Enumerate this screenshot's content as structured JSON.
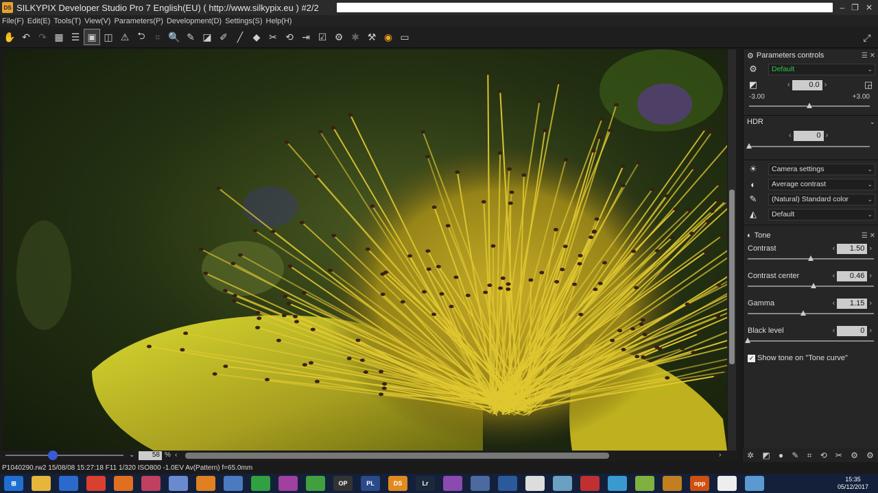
{
  "window": {
    "title": "SILKYPIX Developer Studio Pro 7 English(EU) ( http://www.silkypix.eu )  #2/2",
    "icon_label": "DS"
  },
  "menu": [
    "File(F)",
    "Edit(E)",
    "Tools(T)",
    "View(V)",
    "Parameters(P)",
    "Development(D)",
    "Settings(S)",
    "Help(H)"
  ],
  "toolbar": {
    "icons": [
      "hand-icon",
      "undo-icon",
      "redo-icon",
      "grid-view-icon",
      "filmstrip-view-icon",
      "single-view-icon",
      "compare-view-icon",
      "warning-icon",
      "rotate-left-icon",
      "crop-icon",
      "zoom-icon",
      "eyedropper-icon",
      "white-balance-icon",
      "spot-icon",
      "brush-icon",
      "gradient-icon",
      "tone-icon",
      "rotate-icon",
      "export-icon",
      "check-icon",
      "settings-icon",
      "star-icon",
      "hammer-icon",
      "ds-icon",
      "monitor-icon"
    ]
  },
  "viewer": {
    "zoom_value": "58",
    "zoom_unit": "%"
  },
  "status": {
    "text": "P1040290.rw2 15/08/08 15:27:18 F11 1/320 ISO800 -1.0EV Av(Pattern) f=65.0mm"
  },
  "panel": {
    "title": "Parameters controls",
    "taste": "Default",
    "exposure": {
      "value": "0.0",
      "min": "-3.00",
      "max": "+3.00",
      "level": 0.5
    },
    "hdr": {
      "label": "HDR",
      "value": "0",
      "level": 0.0
    },
    "selects": [
      "Camera settings",
      "Average contrast",
      "(Natural) Standard color",
      "Default"
    ],
    "tone": {
      "title": "Tone",
      "items": [
        {
          "label": "Contrast",
          "value": "1.50",
          "level": 0.5
        },
        {
          "label": "Contrast center",
          "value": "0.46",
          "level": 0.52
        },
        {
          "label": "Gamma",
          "value": "1.15",
          "level": 0.44
        },
        {
          "label": "Black level",
          "value": "0",
          "level": 0.0
        }
      ],
      "checkbox": "Show tone on \"Tone curve\""
    }
  },
  "taskbar": {
    "time": "15:35",
    "date": "05/12/2017",
    "apps": [
      {
        "name": "windows",
        "label": "⊞",
        "color": "#1f6fd0"
      },
      {
        "name": "explorer",
        "label": "",
        "color": "#e6b53a"
      },
      {
        "name": "outlook",
        "label": "",
        "color": "#2a6acc"
      },
      {
        "name": "chrome",
        "label": "",
        "color": "#d94030"
      },
      {
        "name": "firefox",
        "label": "",
        "color": "#e07020"
      },
      {
        "name": "paint",
        "label": "",
        "color": "#c04060"
      },
      {
        "name": "app7",
        "label": "",
        "color": "#6a8ad0"
      },
      {
        "name": "app8",
        "label": "",
        "color": "#e08020"
      },
      {
        "name": "app9",
        "label": "",
        "color": "#4a7ac0"
      },
      {
        "name": "app10",
        "label": "",
        "color": "#30a040"
      },
      {
        "name": "app11",
        "label": "",
        "color": "#a040a0"
      },
      {
        "name": "app12",
        "label": "",
        "color": "#40a040"
      },
      {
        "name": "dxo",
        "label": "OP",
        "color": "#333"
      },
      {
        "name": "photolab",
        "label": "PL",
        "color": "#2a4a8a"
      },
      {
        "name": "silkypix",
        "label": "DS",
        "color": "#e08a20"
      },
      {
        "name": "lightroom",
        "label": "Lr",
        "color": "#1a2a3a"
      },
      {
        "name": "app17",
        "label": "",
        "color": "#8a4ab0"
      },
      {
        "name": "app18",
        "label": "",
        "color": "#4a6aa0"
      },
      {
        "name": "app19",
        "label": "",
        "color": "#2a5a9a"
      },
      {
        "name": "app20",
        "label": "",
        "color": "#ddd"
      },
      {
        "name": "app21",
        "label": "",
        "color": "#6aa0c0"
      },
      {
        "name": "app22",
        "label": "",
        "color": "#c03030"
      },
      {
        "name": "app23",
        "label": "",
        "color": "#3a9ad0"
      },
      {
        "name": "app24",
        "label": "",
        "color": "#80b040"
      },
      {
        "name": "app25",
        "label": "",
        "color": "#c08020"
      },
      {
        "name": "app26",
        "label": "opp",
        "color": "#d05010"
      },
      {
        "name": "app27",
        "label": "",
        "color": "#eee"
      },
      {
        "name": "app28",
        "label": "",
        "color": "#5a9ad0"
      }
    ]
  }
}
